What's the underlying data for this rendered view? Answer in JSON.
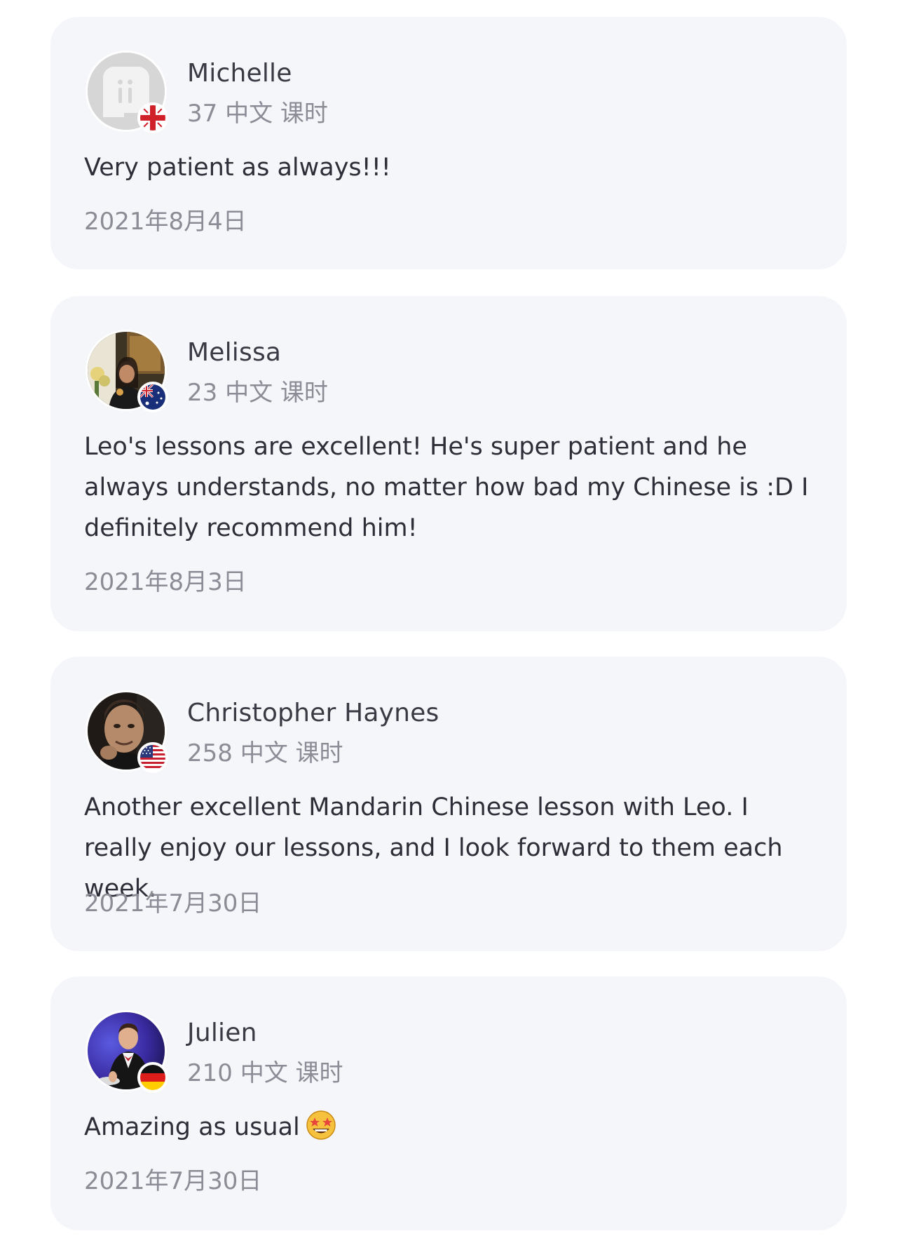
{
  "reviews": [
    {
      "name": "Michelle",
      "lessons": "37 中文 课时",
      "text": "Very patient as always!!!",
      "date": "2021年8月4日",
      "avatar_icon": "default-avatar-icon",
      "flag_icon": "uk-flag-icon"
    },
    {
      "name": "Melissa",
      "lessons": "23 中文 课时",
      "text": "Leo's lessons are excellent! He's super patient and he always understands, no matter how bad my Chinese is :D I definitely recommend him!",
      "date": "2021年8月3日",
      "avatar_icon": "user-photo-avatar",
      "flag_icon": "australia-flag-icon"
    },
    {
      "name": "Christopher Haynes",
      "lessons": "258 中文 课时",
      "text": "Another excellent Mandarin Chinese lesson with Leo. I really enjoy our lessons, and I look forward to them each week.",
      "date": "2021年7月30日",
      "avatar_icon": "user-photo-avatar",
      "flag_icon": "usa-flag-icon"
    },
    {
      "name": "Julien",
      "lessons": "210 中文 课时",
      "text": "Amazing as usual",
      "date": "2021年7月30日",
      "avatar_icon": "user-photo-avatar",
      "flag_icon": "germany-flag-icon",
      "emoji_icon": "star-struck-emoji-icon"
    }
  ],
  "colors": {
    "card_bg": "#f5f6fa",
    "name_text": "#3a3a44",
    "secondary_text": "#8c8c96",
    "body_text": "#2e2e38"
  }
}
